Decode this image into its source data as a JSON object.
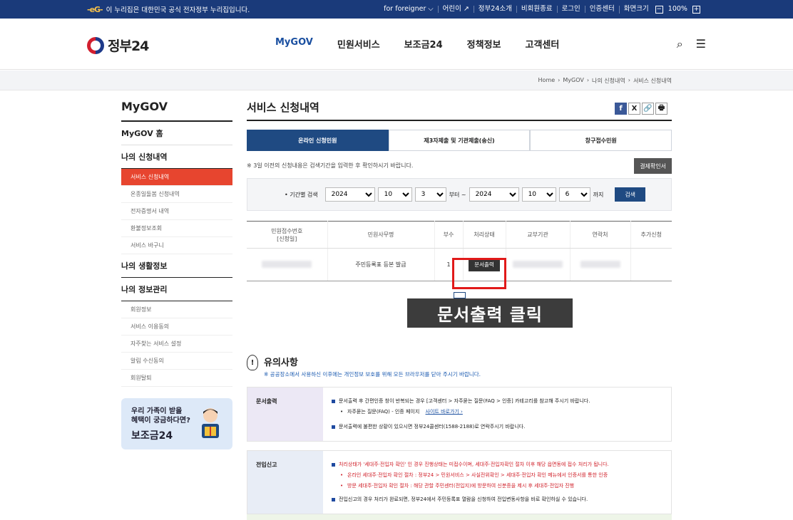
{
  "topbar": {
    "gov_logo": "-eG-",
    "notice": "이 누리집은 대한민국 공식 전자정부 누리집입니다.",
    "links": [
      "for foreigner ⌵",
      "어린이 ↗",
      "정부24소개",
      "비회원종료",
      "로그인",
      "인증센터",
      "화면크기"
    ],
    "zoom_minus": "−",
    "zoom_value": "100%",
    "zoom_plus": "+"
  },
  "header": {
    "logo_text": "정부24",
    "nav": [
      "MyGOV",
      "민원서비스",
      "보조금24",
      "정책정보",
      "고객센터"
    ],
    "search_icon": "⌕",
    "menu_icon": "☰"
  },
  "breadcrumb": [
    "Home",
    "›",
    "MyGOV",
    "›",
    "나의 신청내역",
    "›",
    "서비스 신청내역"
  ],
  "sidebar": {
    "title": "MyGOV",
    "home": "MyGOV 홈",
    "section1": "나의 신청내역",
    "section1_items": [
      "서비스 신청내역",
      "온종일돌봄 신청내역",
      "전자증명서 내역",
      "환불정보조회",
      "서비스 바구니"
    ],
    "section2": "나의 생활정보",
    "section3": "나의 정보관리",
    "section3_items": [
      "회원정보",
      "서비스 이용동의",
      "자주찾는 서비스 설정",
      "알림 수신동의",
      "회원탈퇴"
    ],
    "promo_line1": "우리 가족이 받을",
    "promo_line2": "혜택이 궁금하다면?",
    "promo_brand": "보조금24"
  },
  "main": {
    "title": "서비스 신청내역",
    "share": {
      "fb": "f",
      "x": "X",
      "link": "🔗",
      "print": "🖶"
    },
    "tabs": [
      "온라인 신청민원",
      "제3자제출 및 기관제출(송신)",
      "창구접수민원"
    ],
    "note": "※ 3일 이전의 신청내용은 검색기간을 입력한 후 확인하시기 바랍니다.",
    "proof_button": "결제확인서",
    "search": {
      "label": "• 기간별 검색",
      "from_year": "2024",
      "from_month": "10",
      "from_day": "3",
      "from_suffix": "부터 ~",
      "to_year": "2024",
      "to_month": "10",
      "to_day": "6",
      "to_suffix": "까지",
      "button": "검색"
    },
    "table": {
      "headers": [
        "민원접수번호\n[신청일]",
        "민원사무명",
        "부수",
        "처리상태",
        "교부기관",
        "연락처",
        "추가신청"
      ],
      "row": {
        "name": "주민등록표 등본 발급",
        "count": "1",
        "status_button": "문서출력"
      }
    }
  },
  "callout": "문서출력 클릭",
  "notice": {
    "title": "유의사항",
    "subtitle": "※ 공공장소에서 사용하신 이후에는 개인정보 보호를 위해 모든 브라우저를 닫아 주시기 바랍니다.",
    "box1_label": "문서출력",
    "box1_line1": "문서출력 후 간편인증 창이 반복되는 경우 [고객센터 > 자주묻는 질문(FAQ > 인증] 카테고리를 참고해 주시기 바랍니다.",
    "box1_sub": "자주묻는 질문(FAQ) - 인증 페이지",
    "box1_link": "사이트 바로가기 ›",
    "box1_line2": "문서출력에 불편한 상황이 있으시면 정부24콜센터(1588-2188)로 연락주시기 바랍니다.",
    "box2_label": "전입신고",
    "box2_line1": "처리상태가 '세대주·전입자 확인' 인 경우 진행상태는 미접수이며, 세대주·전입자확인 절차 이후 해당 읍면동에 접수 처리가 됩니다.",
    "box2_sub1": "온라인 세대주·전입자 확인 절차 : 정부24 > 민원서비스 > 사실전위확인 > 세대주·전입자 확인 메뉴에서 인증서를 통한 인증",
    "box2_sub2": "방문 세대주·전입자 확인 절차 : 해당 관할 주민센터(전입지)에 방문하여 신분증을 제시 후 세대주·전입자 진행",
    "box2_line2": "전입신고의 경우 처리가 완료되면, 정부24에서 주민등록표 열람을 신청하여 전입변동사항을 바로 확인하실 수 있습니다."
  }
}
